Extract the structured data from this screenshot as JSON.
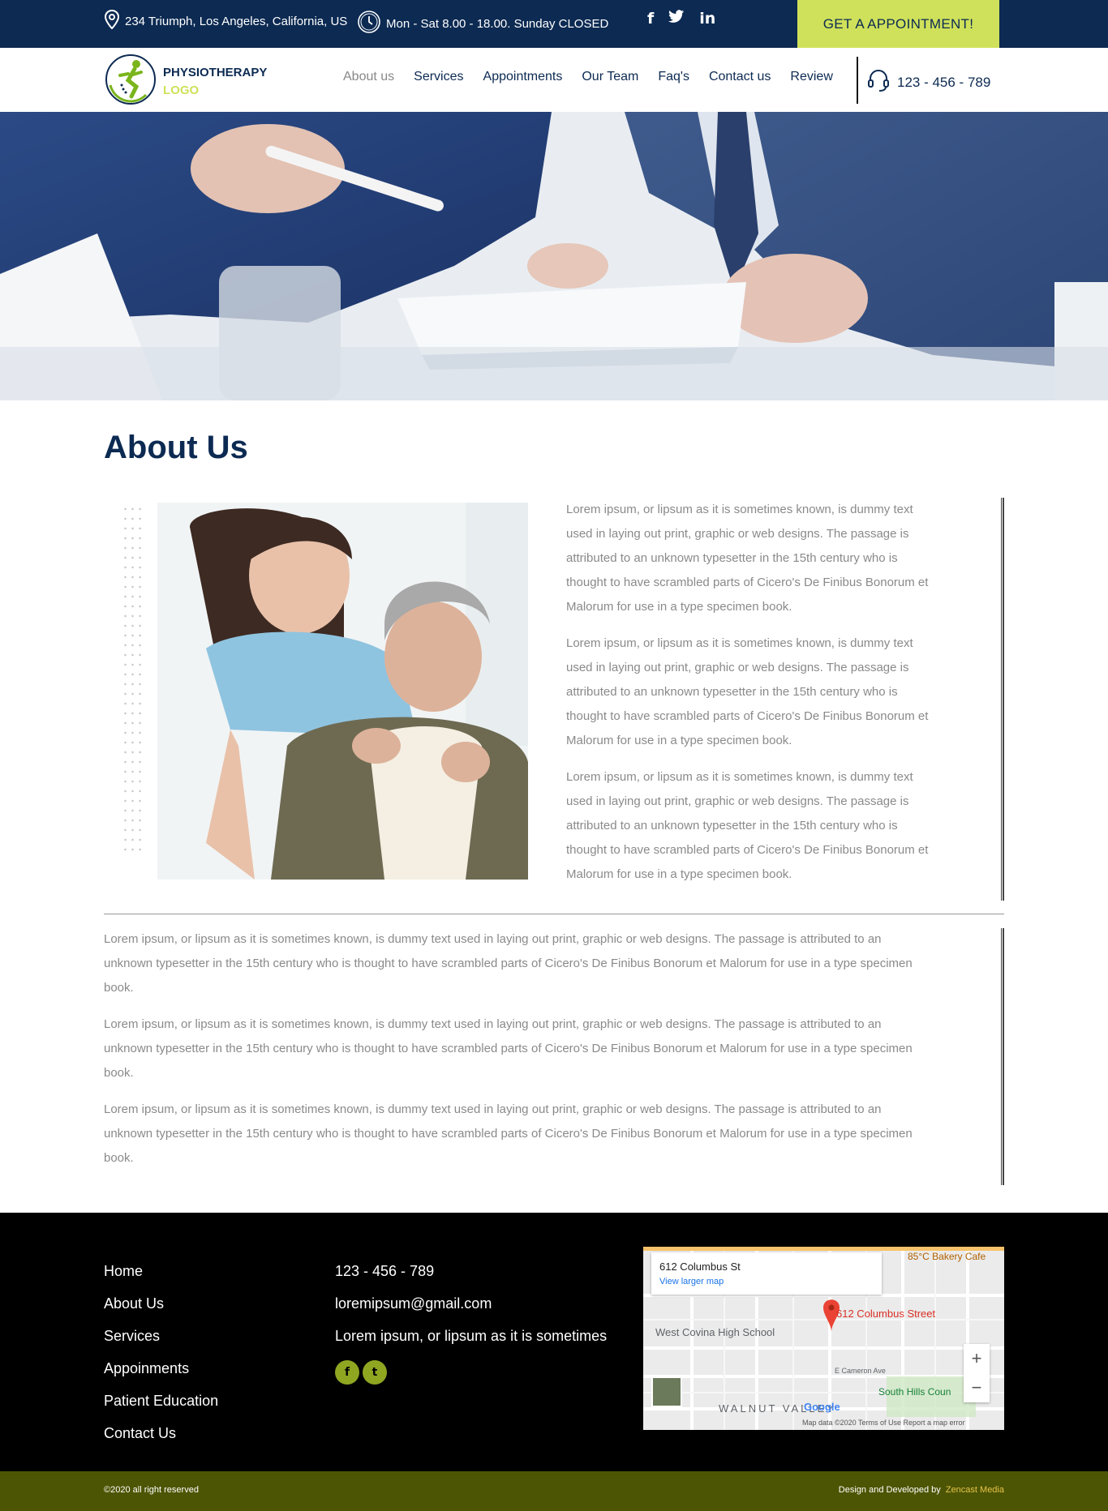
{
  "topbar": {
    "address": "234 Triumph, Los Angeles, California, US",
    "hours": "Mon - Sat 8.00 - 18.00. Sunday CLOSED",
    "social": [
      "f",
      "t",
      "in"
    ],
    "cta": "GET A APPOINTMENT!",
    "cta_color": "#cfe15a",
    "bar_color": "#0c2a52"
  },
  "nav": {
    "brand_line1": "PHYSIOTHERAPY",
    "brand_line2": "LOGO",
    "items": [
      {
        "label": "About us"
      },
      {
        "label": "Services"
      },
      {
        "label": "Appointments"
      },
      {
        "label": "Our Team"
      },
      {
        "label": "Faq's"
      },
      {
        "label": "Contact us"
      },
      {
        "label": "Review"
      }
    ],
    "phone": "123 - 456 - 789"
  },
  "about": {
    "title": "About Us",
    "paragraphs": [
      "Lorem ipsum, or lipsum as it is sometimes known, is dummy text used in laying out print, graphic or web designs. The passage is attributed to an unknown typesetter in the 15th century who is thought to have scrambled parts of Cicero's De Finibus Bonorum et Malorum for use in a type specimen book.",
      "Lorem ipsum, or lipsum as it is sometimes known, is dummy text used in laying out print, graphic or web designs. The passage is attributed to an unknown typesetter in the 15th century who is thought to have scrambled parts of Cicero's De Finibus Bonorum et Malorum for use in a type specimen book.",
      "Lorem ipsum, or lipsum as it is sometimes known, is dummy text used in laying out print, graphic or web designs. The passage is attributed to an unknown typesetter in the 15th century who is thought to have scrambled parts of Cicero's De Finibus Bonorum et Malorum for use in a type specimen book."
    ],
    "full_paragraphs": [
      "Lorem ipsum, or lipsum as it is sometimes known, is dummy text used in laying out print, graphic or web designs. The passage is attributed to an unknown typesetter in the 15th century who is thought to have scrambled parts of Cicero's De Finibus Bonorum et Malorum for use in a type specimen book.",
      "Lorem ipsum, or lipsum as it is sometimes known, is dummy text used in laying out print, graphic or web designs. The passage is attributed to an unknown typesetter in the 15th century who is thought to have scrambled parts of Cicero's De Finibus Bonorum et Malorum for use in a type specimen book.",
      "Lorem ipsum, or lipsum as it is sometimes known, is dummy text used in laying out print, graphic or web designs. The passage is attributed to an unknown typesetter in the 15th century who is thought to have scrambled parts of Cicero's De Finibus Bonorum et Malorum for use in a type specimen book."
    ]
  },
  "footer": {
    "links": [
      {
        "label": "Home"
      },
      {
        "label": "About Us"
      },
      {
        "label": "Services"
      },
      {
        "label": "Appoinments"
      },
      {
        "label": "Patient Education"
      },
      {
        "label": "Contact Us"
      }
    ],
    "phone": "123 - 456 - 789",
    "email": "loremipsum@gmail.com",
    "tagline": "Lorem ipsum, or lipsum as it is sometimes",
    "social": [
      "f",
      "t"
    ],
    "map": {
      "address": "612 Columbus St",
      "view_larger": "View larger map",
      "pin_label": "612 Columbus Street",
      "poi": "West Covina High School",
      "bakery": "85°C Bakery Cafe",
      "street": "E Cameron Ave",
      "park": "South Hills Coun",
      "area": "WALNUT VALLEY",
      "google": "Google",
      "attribution": "Map data ©2020   Terms of Use   Report a map error",
      "zoom_in": "+",
      "zoom_out": "−"
    },
    "copyright": "©2020 all right reserved",
    "credit_prefix": "Design and Developed by",
    "credit_company": "Zencast Media"
  }
}
